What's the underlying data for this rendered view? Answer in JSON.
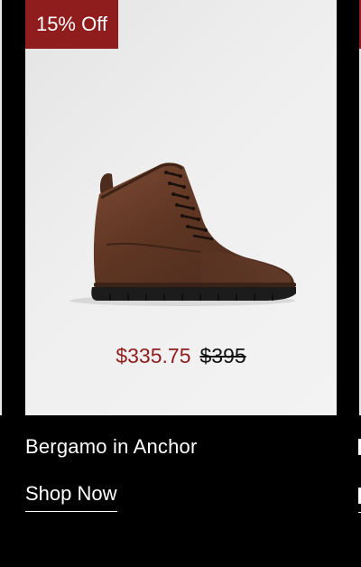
{
  "product": {
    "badge": "15% Off",
    "sale_price": "$335.75",
    "original_price": "$395",
    "name": "Bergamo in Anchor",
    "cta_label": "Shop Now"
  },
  "colors": {
    "badge_bg": "#8f1d1d",
    "sale_price": "#8f1d1d",
    "background": "#000000",
    "card_bg": "#efefef"
  },
  "icons": {
    "product_image": "brown-leather-lace-up-boot"
  }
}
